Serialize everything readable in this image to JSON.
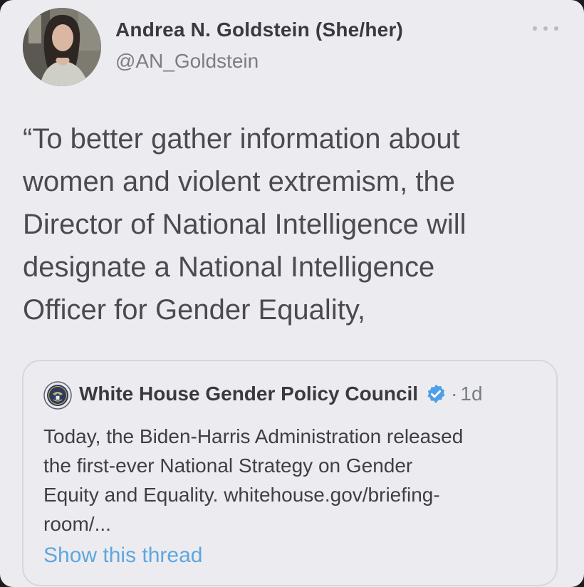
{
  "tweet": {
    "author": {
      "name": "Andrea N. Goldstein (She/her)",
      "handle": "@AN_Goldstein",
      "avatar_icon": "profile-photo"
    },
    "more_icon": "more-dots-icon",
    "text_lines": [
      "“To better gather information about",
      "women and violent extremism, the",
      "Director of National Intelligence will",
      "designate a National Intelligence",
      "Officer for Gender Equality,"
    ]
  },
  "quoted_tweet": {
    "author": "White House Gender Policy Council",
    "verified": true,
    "separator": "·",
    "time": "1d",
    "seal_icon": "presidential-seal-icon",
    "verified_icon": "verified-badge-icon",
    "body_lines": [
      "Today, the Biden-Harris Administration released",
      "the first-ever National Strategy on Gender",
      "Equity and Equality. whitehouse.gov/briefing-",
      "room/..."
    ],
    "show_thread_label": "Show this thread"
  },
  "colors": {
    "background": "#ececf0",
    "text_primary": "#3a3a3e",
    "text_secondary": "#7a7d83",
    "link": "#5fa6dd",
    "verified": "#4f9fe8"
  }
}
